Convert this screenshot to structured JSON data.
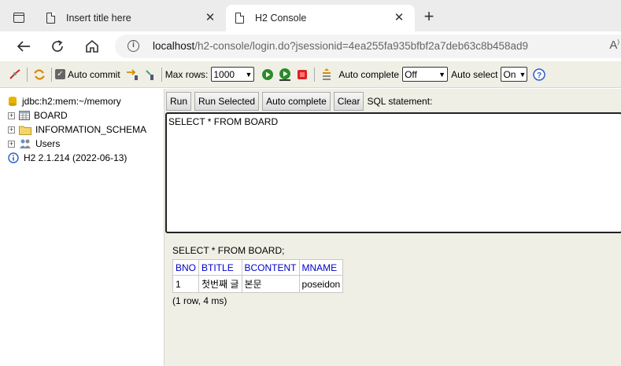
{
  "browser": {
    "tabs": [
      {
        "title": "Insert title here",
        "active": false
      },
      {
        "title": "H2 Console",
        "active": true
      }
    ],
    "url_host": "localhost",
    "url_path": "/h2-console/login.do?jsessionid=4ea255fa935bfbf2a7deb63c8b458ad9"
  },
  "toolbar": {
    "auto_commit_label": "Auto commit",
    "max_rows_label": "Max rows:",
    "max_rows_value": "1000",
    "auto_complete_label": "Auto complete",
    "auto_complete_value": "Off",
    "auto_select_label": "Auto select",
    "auto_select_value": "On"
  },
  "tree": {
    "connection": "jdbc:h2:mem:~/memory",
    "items": [
      {
        "label": "BOARD"
      },
      {
        "label": "INFORMATION_SCHEMA"
      },
      {
        "label": "Users"
      }
    ],
    "version": "H2 2.1.214 (2022-06-13)"
  },
  "editor": {
    "buttons": [
      "Run",
      "Run Selected",
      "Auto complete",
      "Clear"
    ],
    "sql_label": "SQL statement:",
    "sql_text": "SELECT * FROM BOARD"
  },
  "result": {
    "sql": "SELECT * FROM BOARD;",
    "columns": [
      "BNO",
      "BTITLE",
      "BCONTENT",
      "MNAME"
    ],
    "rows": [
      [
        "1",
        "첫번째 글",
        "본문",
        "poseidon"
      ]
    ],
    "status": "(1 row, 4 ms)"
  },
  "colors": {
    "panel_bg": "#f0efe6",
    "header_blue": "#0000cc"
  }
}
